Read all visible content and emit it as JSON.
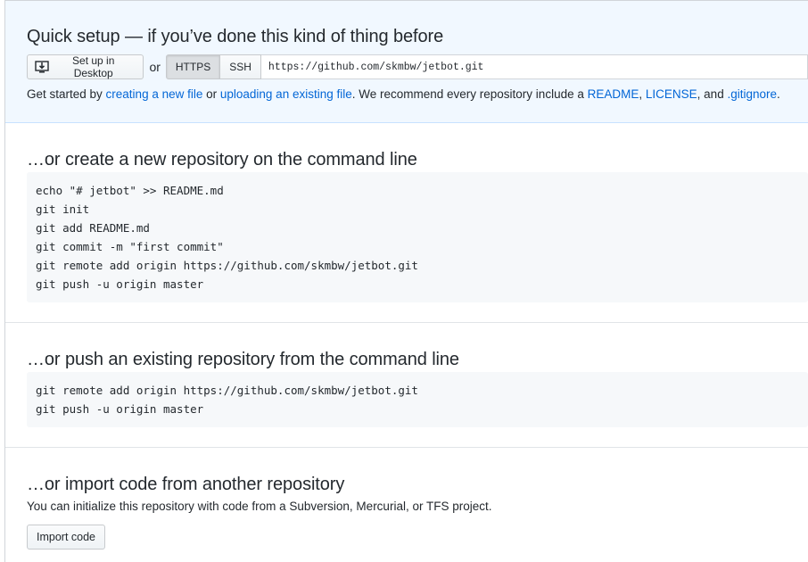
{
  "quick_setup": {
    "title": "Quick setup — if you’ve done this kind of thing before",
    "desktop_button": "Set up in Desktop",
    "or": "or",
    "https_button": "HTTPS",
    "ssh_button": "SSH",
    "clone_url": "https://github.com/skmbw/jetbot.git",
    "text": {
      "get_started": "Get started by ",
      "new_file_link": "creating a new file",
      "or_text": " or ",
      "upload_link": "uploading an existing file",
      "recommend": ". We recommend every repository include a ",
      "readme_link": "README",
      "comma": ", ",
      "license_link": "LICENSE",
      "and_text": ", and ",
      "gitignore_link": ".gitignore",
      "period": "."
    }
  },
  "new_repo": {
    "title": "…or create a new repository on the command line",
    "code": "echo \"# jetbot\" >> README.md\ngit init\ngit add README.md\ngit commit -m \"first commit\"\ngit remote add origin https://github.com/skmbw/jetbot.git\ngit push -u origin master"
  },
  "push_existing": {
    "title": "…or push an existing repository from the command line",
    "code": "git remote add origin https://github.com/skmbw/jetbot.git\ngit push -u origin master"
  },
  "import_code": {
    "title": "…or import code from another repository",
    "text": "You can initialize this repository with code from a Subversion, Mercurial, or TFS project.",
    "button": "Import code"
  },
  "icons": {
    "desktop": "desktop-download-icon"
  }
}
